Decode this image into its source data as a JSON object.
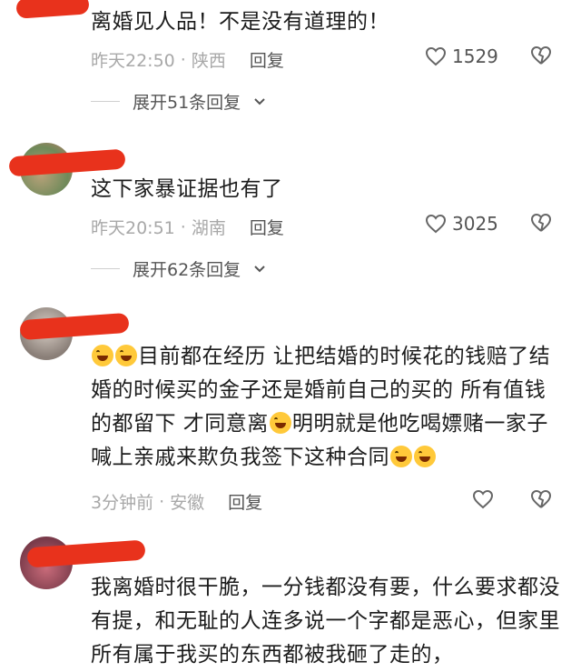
{
  "comments": [
    {
      "text": "离婚见人品！不是没有道理的！",
      "time": "昨天22:50",
      "location": "陕西",
      "reply": "回复",
      "likes": "1529",
      "expand": "展开51条回复"
    },
    {
      "text": "这下家暴证据也有了",
      "time": "昨天20:51",
      "location": "湖南",
      "reply": "回复",
      "likes": "3025",
      "expand": "展开62条回复"
    },
    {
      "text_seg1": "目前都在经历 让把结婚的时候花的钱赔了结婚的时候买的金子还是婚前自己的买的 所有值钱的都留下 才同意离",
      "text_seg2": "明明就是他吃喝嫖赌一家子喊上亲戚来欺负我签下这种合同",
      "time": "3分钟前",
      "location": "安徽",
      "reply": "回复",
      "likes": ""
    },
    {
      "text": "我离婚时很干脆，一分钱都没有要，什么要求都没有提，和无耻的人连多说一个字都是恶心，但家里所有属于我买的东西都被我砸了走的，"
    }
  ],
  "separator": "·"
}
